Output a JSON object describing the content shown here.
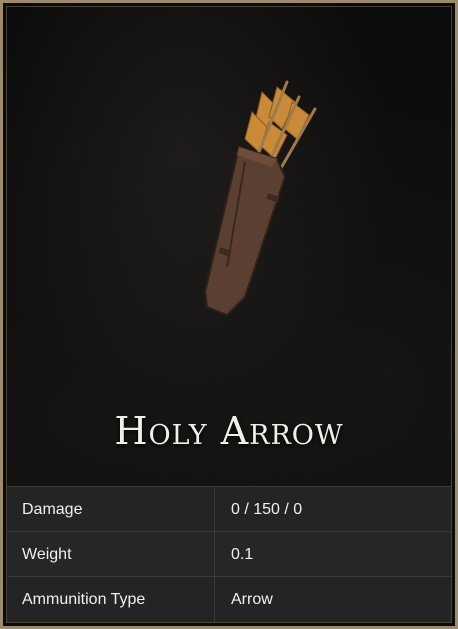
{
  "item": {
    "name": "Holy Arrow",
    "image_icon": "quiver-icon"
  },
  "stats": [
    {
      "label": "Damage",
      "value": "0 / 150 / 0"
    },
    {
      "label": "Weight",
      "value": "0.1"
    },
    {
      "label": "Ammunition Type",
      "value": "Arrow"
    }
  ],
  "colors": {
    "frame": "#9c8b6c",
    "panel": "#242424",
    "title": "#f2efe9"
  }
}
